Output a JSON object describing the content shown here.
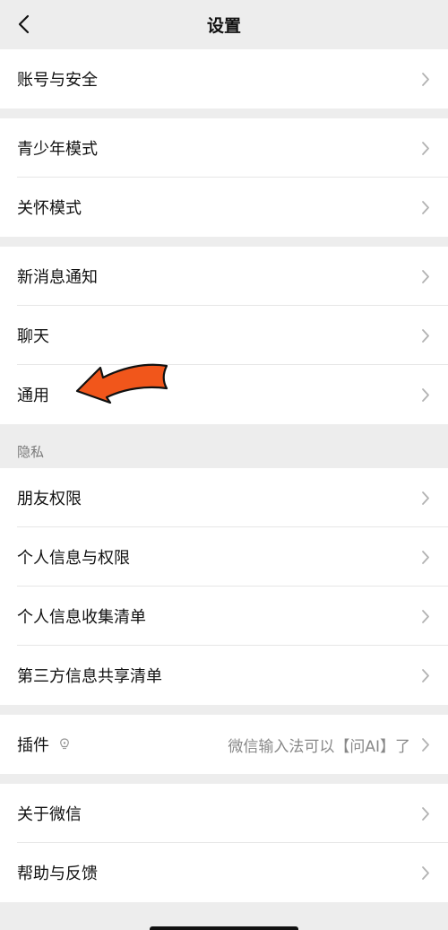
{
  "header": {
    "title": "设置",
    "back_icon": "chevron-left-icon"
  },
  "groups": [
    {
      "items": [
        {
          "label": "账号与安全"
        }
      ]
    },
    {
      "items": [
        {
          "label": "青少年模式"
        },
        {
          "label": "关怀模式"
        }
      ]
    },
    {
      "items": [
        {
          "label": "新消息通知"
        },
        {
          "label": "聊天"
        },
        {
          "label": "通用"
        }
      ]
    },
    {
      "section": "隐私",
      "items": [
        {
          "label": "朋友权限"
        },
        {
          "label": "个人信息与权限"
        },
        {
          "label": "个人信息收集清单"
        },
        {
          "label": "第三方信息共享清单"
        }
      ]
    },
    {
      "items": [
        {
          "label": "插件",
          "value": "微信输入法可以【问AI】了"
        }
      ]
    },
    {
      "items": [
        {
          "label": "关于微信"
        },
        {
          "label": "帮助与反馈"
        }
      ]
    }
  ],
  "annotation": {
    "icon": "orange-pointer-arrow",
    "color": "#f1561b"
  },
  "colors": {
    "background": "#ededed",
    "row": "#ffffff",
    "chevron": "#b2b2b2"
  }
}
